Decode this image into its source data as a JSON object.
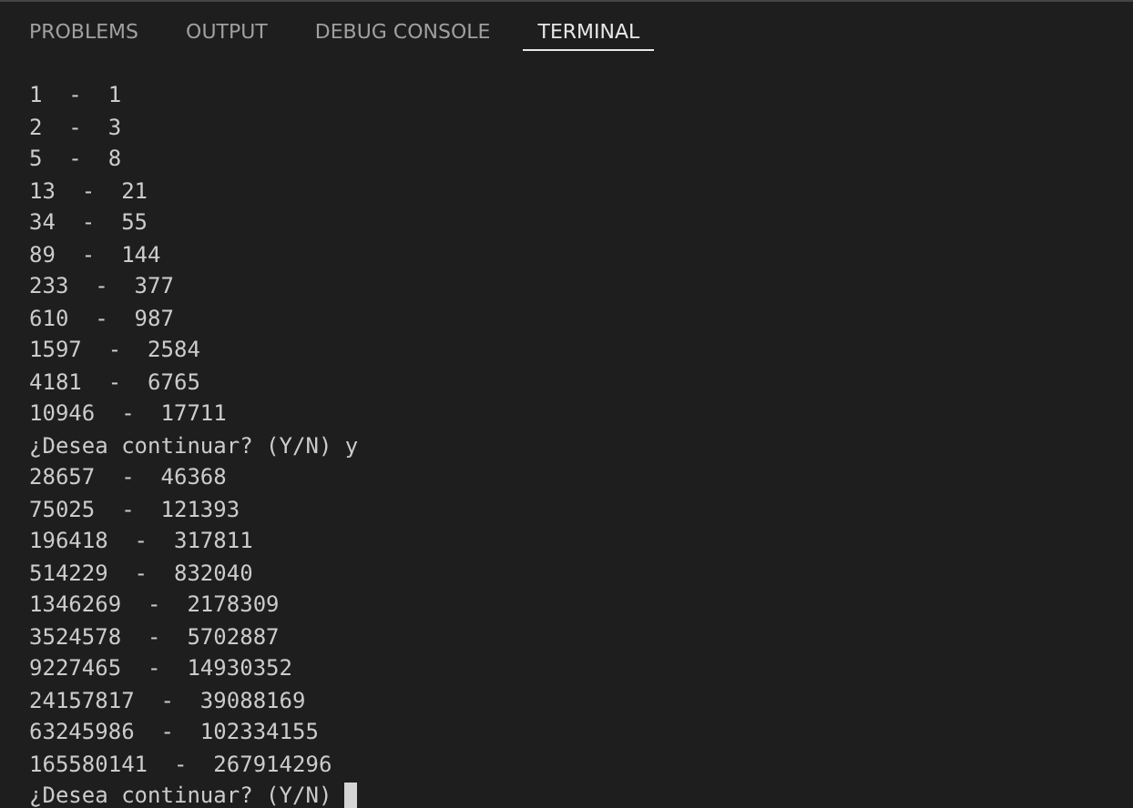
{
  "tabs": [
    {
      "label": "PROBLEMS",
      "selected": false
    },
    {
      "label": "OUTPUT",
      "selected": false
    },
    {
      "label": "DEBUG CONSOLE",
      "selected": false
    },
    {
      "label": "TERMINAL",
      "selected": true
    }
  ],
  "terminal": {
    "lines": [
      "1  -  1",
      "2  -  3",
      "5  -  8",
      "13  -  21",
      "34  -  55",
      "89  -  144",
      "233  -  377",
      "610  -  987",
      "1597  -  2584",
      "4181  -  6765",
      "10946  -  17711",
      "¿Desea continuar? (Y/N) y",
      "28657  -  46368",
      "75025  -  121393",
      "196418  -  317811",
      "514229  -  832040",
      "1346269  -  2178309",
      "3524578  -  5702887",
      "9227465  -  14930352",
      "24157817  -  39088169",
      "63245986  -  102334155",
      "165580141  -  267914296",
      "¿Desea continuar? (Y/N) "
    ],
    "cursor": true
  }
}
